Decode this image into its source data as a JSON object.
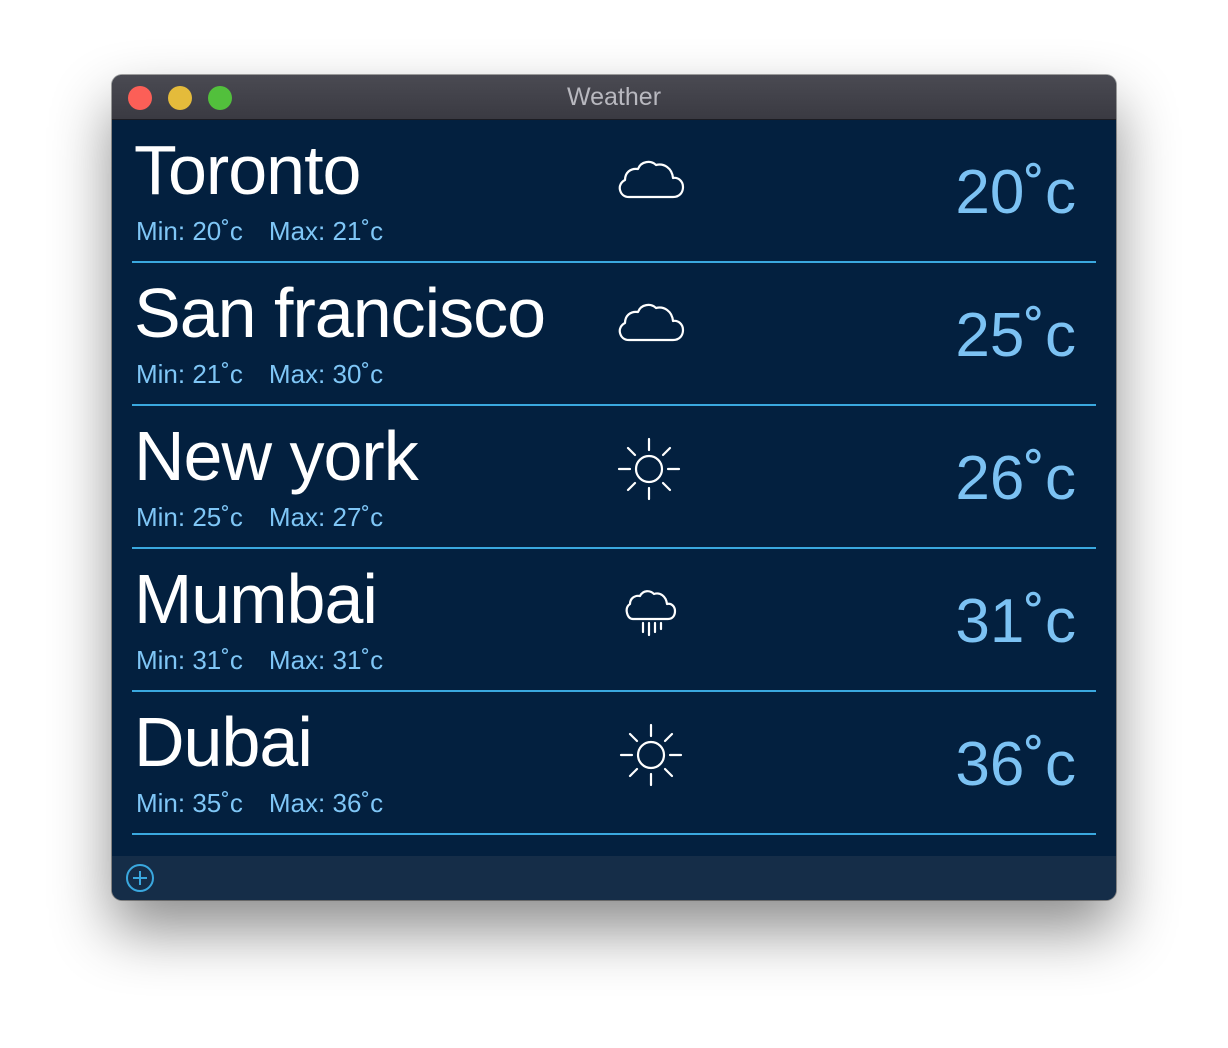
{
  "window": {
    "title": "Weather"
  },
  "cities": [
    {
      "name": "Toronto",
      "min": "Min: 20˚c",
      "max": "Max: 21˚c",
      "temp": "20˚c",
      "icon": "cloud-icon"
    },
    {
      "name": "San francisco",
      "min": "Min: 21˚c",
      "max": "Max: 30˚c",
      "temp": "25˚c",
      "icon": "cloud-icon"
    },
    {
      "name": "New york",
      "min": "Min: 25˚c",
      "max": "Max: 27˚c",
      "temp": "26˚c",
      "icon": "sun-icon"
    },
    {
      "name": "Mumbai",
      "min": "Min: 31˚c",
      "max": "Max: 31˚c",
      "temp": "31˚c",
      "icon": "rain-cloud-icon"
    },
    {
      "name": "Dubai",
      "min": "Min: 35˚c",
      "max": "Max: 36˚c",
      "temp": "36˚c",
      "icon": "sun-icon"
    }
  ],
  "footer": {
    "add_icon": "add-circle-icon"
  },
  "colors": {
    "background": "#03203f",
    "divider": "#3aa8df",
    "temperature": "#7cc2f3",
    "minmax": "#7fc6f6",
    "city": "#ffffff",
    "footer": "#152d48"
  }
}
